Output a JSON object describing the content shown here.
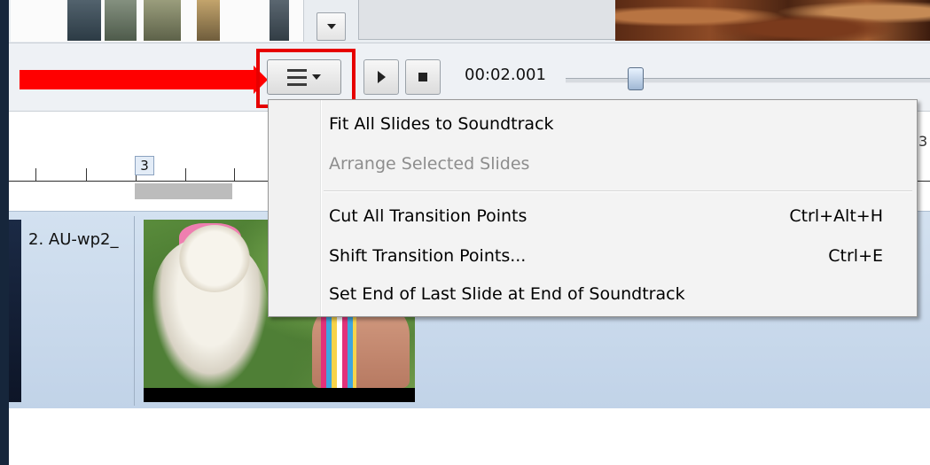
{
  "toolbar": {
    "timecode": "00:02.001",
    "slider_position": 0.17
  },
  "ruler": {
    "marker_label": "3",
    "right_label": "3"
  },
  "timeline": {
    "clip_label": "2. AU-wp2_"
  },
  "menu": {
    "items": [
      {
        "label": "Fit All Slides to Soundtrack",
        "shortcut": "",
        "enabled": true
      },
      {
        "label": "Arrange Selected Slides",
        "shortcut": "",
        "enabled": false
      },
      {
        "label": "Cut All Transition Points",
        "shortcut": "Ctrl+Alt+H",
        "enabled": true
      },
      {
        "label": "Shift Transition Points...",
        "shortcut": "Ctrl+E",
        "enabled": true
      },
      {
        "label": "Set End of Last Slide at End of Soundtrack",
        "shortcut": "",
        "enabled": true
      }
    ]
  },
  "colors": {
    "annotation_red": "#ff0000",
    "timeline_blue": "#c9dbee",
    "window_border": "#16263b"
  },
  "icons": {
    "menu_button": "hamburger-icon",
    "play": "play-icon",
    "stop": "stop-icon"
  }
}
